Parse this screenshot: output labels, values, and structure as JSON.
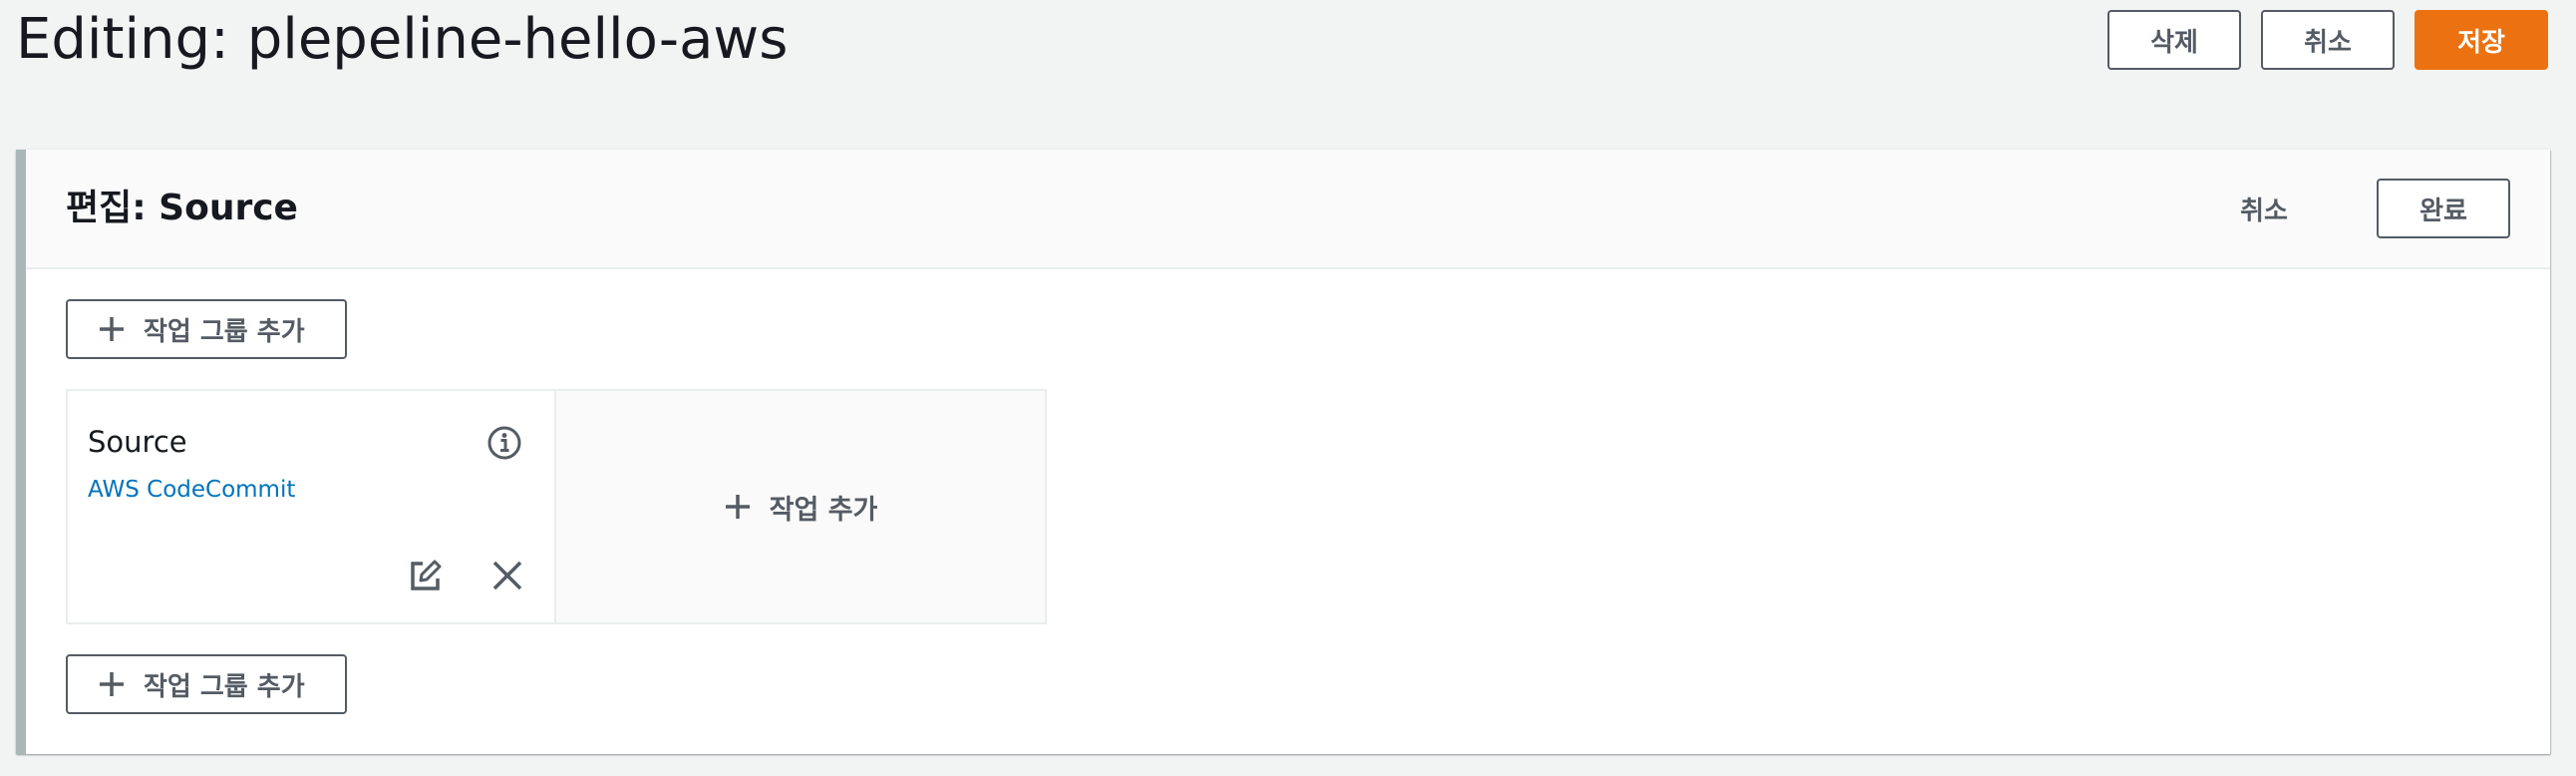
{
  "page": {
    "title": "Editing: plepeline-hello-aws"
  },
  "header_actions": {
    "delete_label": "삭제",
    "cancel_label": "취소",
    "save_label": "저장"
  },
  "stage": {
    "title": "편집: Source",
    "cancel_label": "취소",
    "done_label": "완료",
    "add_group_label": "작업 그룹 추가",
    "action": {
      "name": "Source",
      "provider": "AWS CodeCommit"
    },
    "add_action_label": "작업 추가"
  },
  "colors": {
    "primary": "#ec7211",
    "link": "#0073bb",
    "background": "#f2f3f3"
  },
  "icons": [
    "plus-icon",
    "info-icon",
    "edit-icon",
    "close-icon"
  ]
}
